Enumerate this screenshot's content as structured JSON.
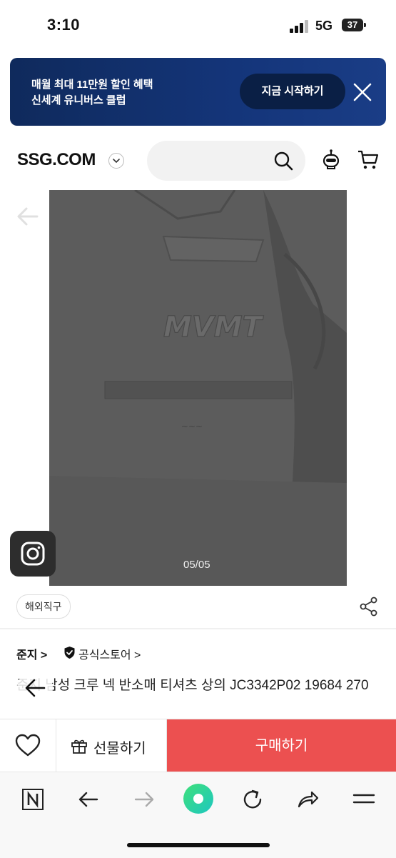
{
  "status_bar": {
    "time": "3:10",
    "network": "5G",
    "battery": "37"
  },
  "promo_banner": {
    "line1": "매월 최대 11만원 할인 혜택",
    "line2": "신세계 유니버스 클럽",
    "cta": "지금 시작하기"
  },
  "header": {
    "logo": "SSG.COM"
  },
  "gallery": {
    "pager": "05/05"
  },
  "product": {
    "tag": "해외직구",
    "brand": "준지 >",
    "official_store": "공식스토어 >",
    "title": "준지 남성 크루 넥 반소매 티셔츠 상의 JC3342P02 19684 270"
  },
  "action_bar": {
    "gift_label": "선물하기",
    "buy_label": "구매하기"
  },
  "colors": {
    "banner_bg": "#14357a",
    "buy_button": "#ec5050"
  }
}
